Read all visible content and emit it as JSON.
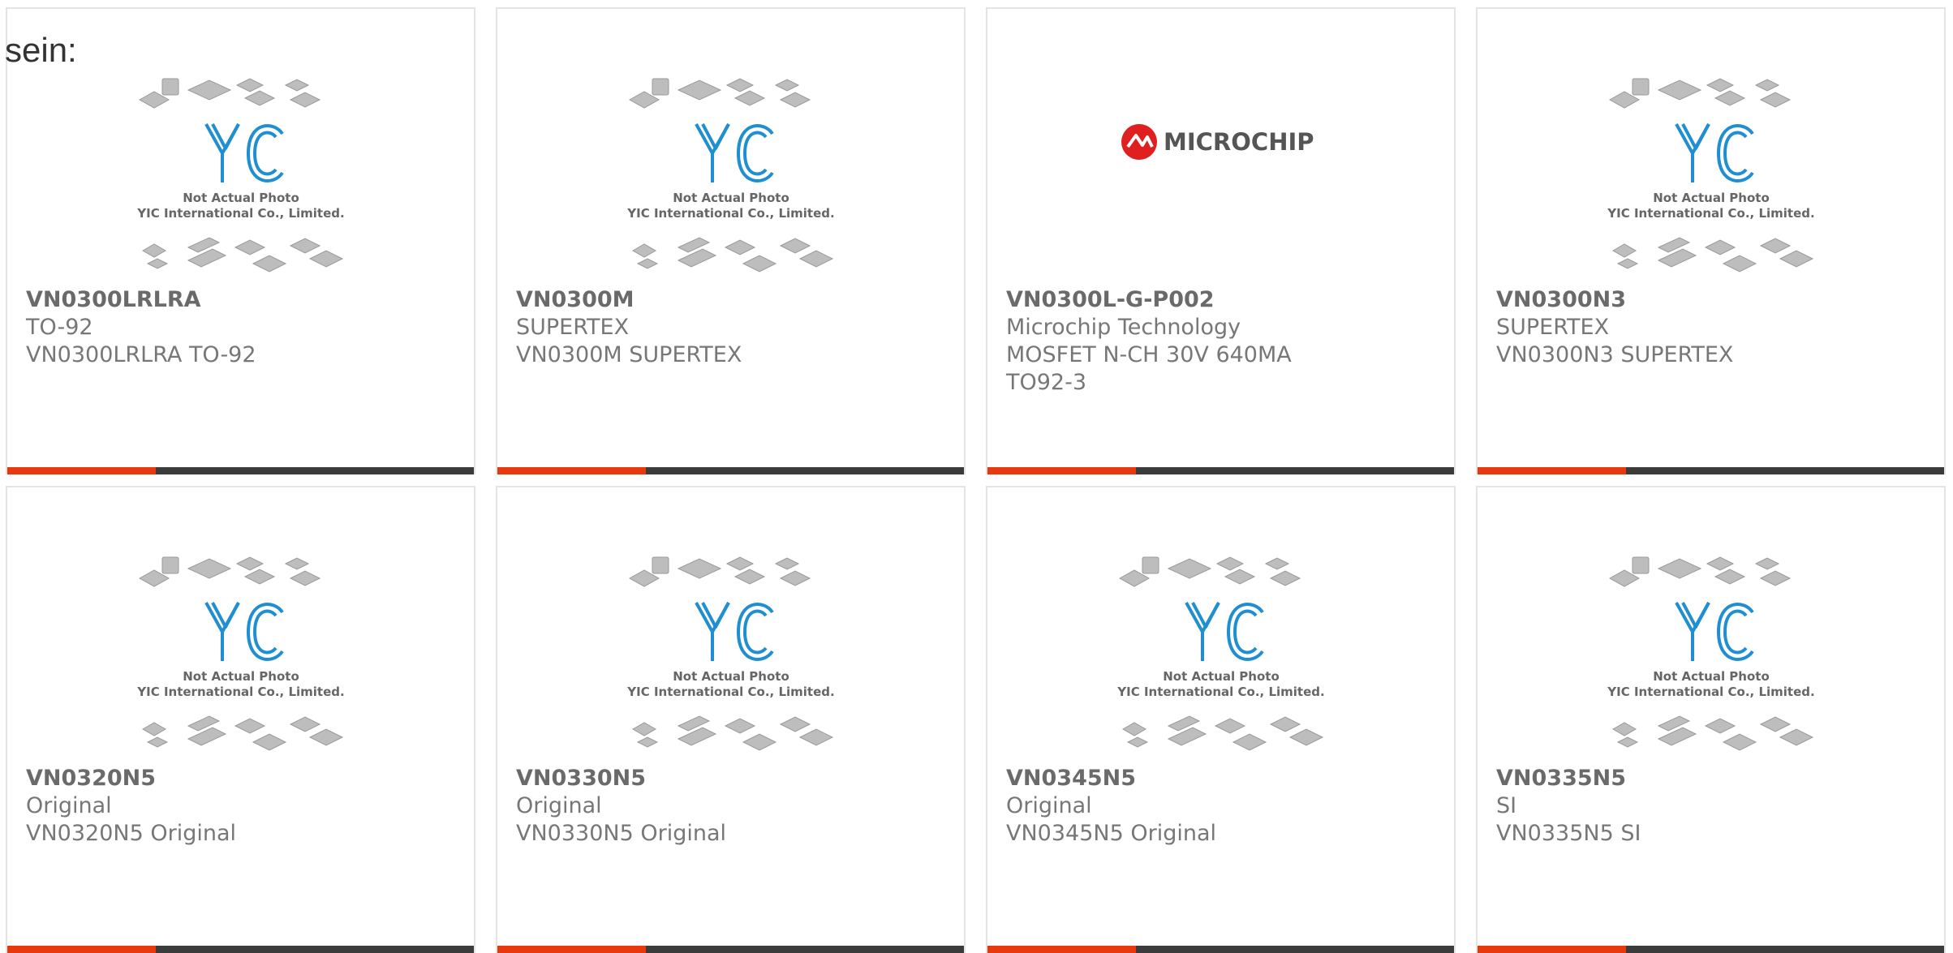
{
  "page": {
    "heading": "sein:"
  },
  "placeholder": {
    "line1": "Not Actual Photo",
    "line2": "YIC International Co., Limited.",
    "logo_text": "YIC"
  },
  "brand_logo": {
    "text": "MICROCHIP",
    "color": "#e02020"
  },
  "colors": {
    "accent": "#e8380d",
    "bar": "#3b3b3b",
    "logo_blue": "#1f8fd1"
  },
  "products": [
    {
      "title": "VN0300LRLRA",
      "line1": "TO-92",
      "line2": "VN0300LRLRA TO-92",
      "image": "yic-placeholder"
    },
    {
      "title": "VN0300M",
      "line1": "SUPERTEX",
      "line2": "VN0300M SUPERTEX",
      "image": "yic-placeholder"
    },
    {
      "title": "VN0300L-G-P002",
      "line1": "Microchip Technology",
      "line2": "MOSFET N-CH 30V 640MA TO92-3",
      "image": "microchip-logo"
    },
    {
      "title": "VN0300N3",
      "line1": "SUPERTEX",
      "line2": "VN0300N3 SUPERTEX",
      "image": "yic-placeholder"
    },
    {
      "title": "VN0320N5",
      "line1": "Original",
      "line2": "VN0320N5 Original",
      "image": "yic-placeholder"
    },
    {
      "title": "VN0330N5",
      "line1": "Original",
      "line2": "VN0330N5 Original",
      "image": "yic-placeholder"
    },
    {
      "title": "VN0345N5",
      "line1": "Original",
      "line2": "VN0345N5 Original",
      "image": "yic-placeholder"
    },
    {
      "title": "VN0335N5",
      "line1": "SI",
      "line2": "VN0335N5 SI",
      "image": "yic-placeholder"
    }
  ]
}
